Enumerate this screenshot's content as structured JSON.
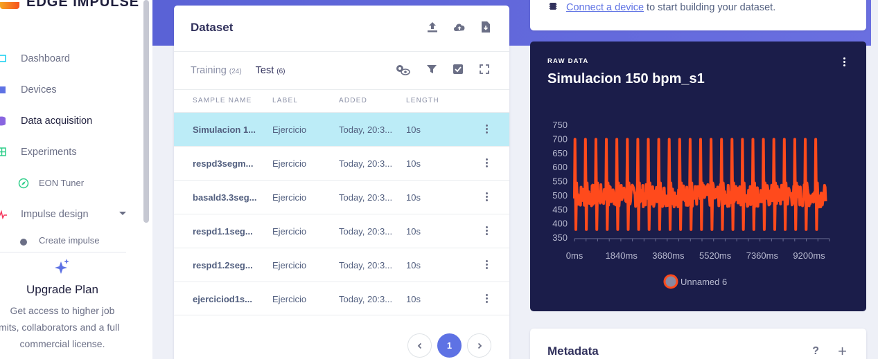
{
  "sidebar": {
    "brand": "EDGE IMPULSE",
    "items": [
      {
        "label": "Dashboard"
      },
      {
        "label": "Devices"
      },
      {
        "label": "Data acquisition"
      },
      {
        "label": "Experiments"
      },
      {
        "label": "EON Tuner"
      },
      {
        "label": "Impulse design"
      },
      {
        "label": "Create impulse"
      }
    ],
    "upgrade": {
      "title": "Upgrade Plan",
      "line1": "Get access to higher job",
      "line2": "limits, collaborators and a full",
      "line3": "commercial license."
    }
  },
  "dataset": {
    "title": "Dataset",
    "tabs": [
      {
        "label": "Training",
        "count": "(24)"
      },
      {
        "label": "Test",
        "count": "(6)"
      }
    ],
    "columns": [
      "SAMPLE NAME",
      "LABEL",
      "ADDED",
      "LENGTH"
    ],
    "rows": [
      {
        "name": "Simulacion 1...",
        "label": "Ejercicio",
        "added": "Today, 20:3...",
        "length": "10s"
      },
      {
        "name": "respd3segm...",
        "label": "Ejercicio",
        "added": "Today, 20:3...",
        "length": "10s"
      },
      {
        "name": "basald3.3seg...",
        "label": "Ejercicio",
        "added": "Today, 20:3...",
        "length": "10s"
      },
      {
        "name": "respd1.1seg...",
        "label": "Ejercicio",
        "added": "Today, 20:3...",
        "length": "10s"
      },
      {
        "name": "respd1.2seg...",
        "label": "Ejercicio",
        "added": "Today, 20:3...",
        "length": "10s"
      },
      {
        "name": "ejerciciod1s...",
        "label": "Ejercicio",
        "added": "Today, 20:3...",
        "length": "10s"
      }
    ],
    "page": "1"
  },
  "connect": {
    "link": "Connect a device",
    "rest": "to start building your dataset."
  },
  "raw": {
    "label": "RAW DATA",
    "title": "Simulacion 150 bpm_s1"
  },
  "metadata": {
    "title": "Metadata",
    "help": "?",
    "add": "+"
  },
  "colors": {
    "accent": "#5e72e4",
    "selected_row": "#bcecf7",
    "raw_bg": "#1b1d4a",
    "signal": "#ff4a1c"
  },
  "chart_data": {
    "type": "line",
    "y_ticks": [
      750,
      700,
      650,
      600,
      550,
      500,
      450,
      400,
      350
    ],
    "x_ticks": [
      "0ms",
      "1840ms",
      "3680ms",
      "5520ms",
      "7360ms",
      "9200ms"
    ],
    "ylim": [
      350,
      750
    ],
    "xlim": [
      0,
      10000
    ],
    "series": [
      {
        "name": "Unnamed 6",
        "color": "#ff4a1c",
        "x": [
          0,
          400,
          800,
          1200,
          1600,
          2000,
          2400,
          2800,
          3200,
          3600,
          4000,
          4400,
          4800,
          5200,
          5600,
          6000,
          6400,
          6800,
          7200,
          7600,
          8000,
          8400,
          8800,
          9200,
          9600
        ],
        "peak": 700,
        "trough": 380,
        "baseline": 490
      }
    ]
  }
}
